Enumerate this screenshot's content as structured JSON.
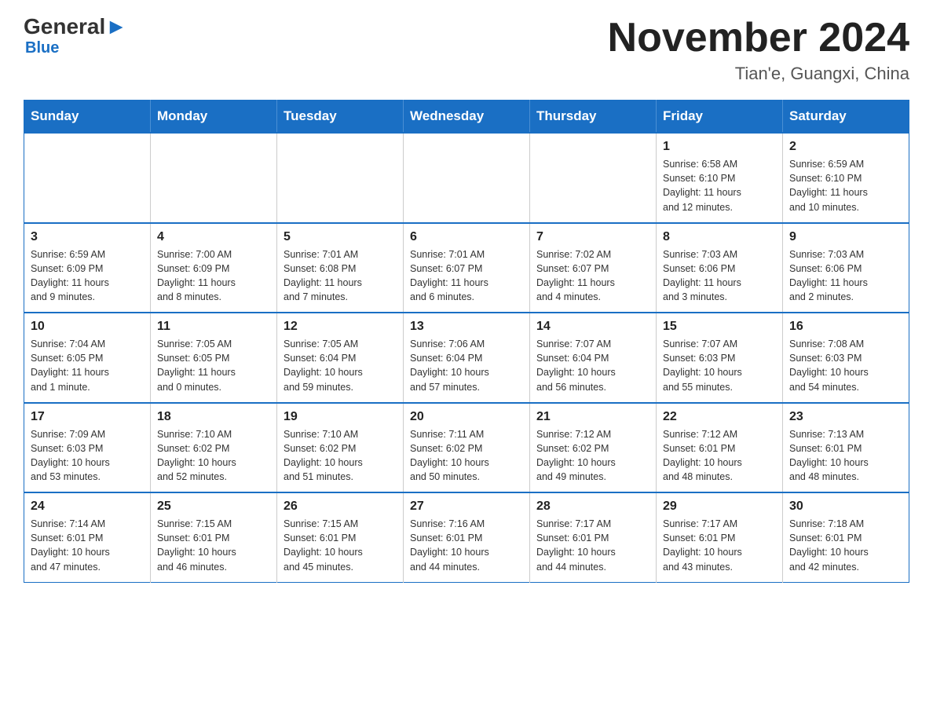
{
  "header": {
    "logo_general": "General",
    "logo_blue": "Blue",
    "month_title": "November 2024",
    "location": "Tian'e, Guangxi, China"
  },
  "weekdays": [
    "Sunday",
    "Monday",
    "Tuesday",
    "Wednesday",
    "Thursday",
    "Friday",
    "Saturday"
  ],
  "weeks": [
    {
      "days": [
        {
          "number": "",
          "info": "",
          "empty": true
        },
        {
          "number": "",
          "info": "",
          "empty": true
        },
        {
          "number": "",
          "info": "",
          "empty": true
        },
        {
          "number": "",
          "info": "",
          "empty": true
        },
        {
          "number": "",
          "info": "",
          "empty": true
        },
        {
          "number": "1",
          "info": "Sunrise: 6:58 AM\nSunset: 6:10 PM\nDaylight: 11 hours\nand 12 minutes."
        },
        {
          "number": "2",
          "info": "Sunrise: 6:59 AM\nSunset: 6:10 PM\nDaylight: 11 hours\nand 10 minutes."
        }
      ]
    },
    {
      "days": [
        {
          "number": "3",
          "info": "Sunrise: 6:59 AM\nSunset: 6:09 PM\nDaylight: 11 hours\nand 9 minutes."
        },
        {
          "number": "4",
          "info": "Sunrise: 7:00 AM\nSunset: 6:09 PM\nDaylight: 11 hours\nand 8 minutes."
        },
        {
          "number": "5",
          "info": "Sunrise: 7:01 AM\nSunset: 6:08 PM\nDaylight: 11 hours\nand 7 minutes."
        },
        {
          "number": "6",
          "info": "Sunrise: 7:01 AM\nSunset: 6:07 PM\nDaylight: 11 hours\nand 6 minutes."
        },
        {
          "number": "7",
          "info": "Sunrise: 7:02 AM\nSunset: 6:07 PM\nDaylight: 11 hours\nand 4 minutes."
        },
        {
          "number": "8",
          "info": "Sunrise: 7:03 AM\nSunset: 6:06 PM\nDaylight: 11 hours\nand 3 minutes."
        },
        {
          "number": "9",
          "info": "Sunrise: 7:03 AM\nSunset: 6:06 PM\nDaylight: 11 hours\nand 2 minutes."
        }
      ]
    },
    {
      "days": [
        {
          "number": "10",
          "info": "Sunrise: 7:04 AM\nSunset: 6:05 PM\nDaylight: 11 hours\nand 1 minute."
        },
        {
          "number": "11",
          "info": "Sunrise: 7:05 AM\nSunset: 6:05 PM\nDaylight: 11 hours\nand 0 minutes."
        },
        {
          "number": "12",
          "info": "Sunrise: 7:05 AM\nSunset: 6:04 PM\nDaylight: 10 hours\nand 59 minutes."
        },
        {
          "number": "13",
          "info": "Sunrise: 7:06 AM\nSunset: 6:04 PM\nDaylight: 10 hours\nand 57 minutes."
        },
        {
          "number": "14",
          "info": "Sunrise: 7:07 AM\nSunset: 6:04 PM\nDaylight: 10 hours\nand 56 minutes."
        },
        {
          "number": "15",
          "info": "Sunrise: 7:07 AM\nSunset: 6:03 PM\nDaylight: 10 hours\nand 55 minutes."
        },
        {
          "number": "16",
          "info": "Sunrise: 7:08 AM\nSunset: 6:03 PM\nDaylight: 10 hours\nand 54 minutes."
        }
      ]
    },
    {
      "days": [
        {
          "number": "17",
          "info": "Sunrise: 7:09 AM\nSunset: 6:03 PM\nDaylight: 10 hours\nand 53 minutes."
        },
        {
          "number": "18",
          "info": "Sunrise: 7:10 AM\nSunset: 6:02 PM\nDaylight: 10 hours\nand 52 minutes."
        },
        {
          "number": "19",
          "info": "Sunrise: 7:10 AM\nSunset: 6:02 PM\nDaylight: 10 hours\nand 51 minutes."
        },
        {
          "number": "20",
          "info": "Sunrise: 7:11 AM\nSunset: 6:02 PM\nDaylight: 10 hours\nand 50 minutes."
        },
        {
          "number": "21",
          "info": "Sunrise: 7:12 AM\nSunset: 6:02 PM\nDaylight: 10 hours\nand 49 minutes."
        },
        {
          "number": "22",
          "info": "Sunrise: 7:12 AM\nSunset: 6:01 PM\nDaylight: 10 hours\nand 48 minutes."
        },
        {
          "number": "23",
          "info": "Sunrise: 7:13 AM\nSunset: 6:01 PM\nDaylight: 10 hours\nand 48 minutes."
        }
      ]
    },
    {
      "days": [
        {
          "number": "24",
          "info": "Sunrise: 7:14 AM\nSunset: 6:01 PM\nDaylight: 10 hours\nand 47 minutes."
        },
        {
          "number": "25",
          "info": "Sunrise: 7:15 AM\nSunset: 6:01 PM\nDaylight: 10 hours\nand 46 minutes."
        },
        {
          "number": "26",
          "info": "Sunrise: 7:15 AM\nSunset: 6:01 PM\nDaylight: 10 hours\nand 45 minutes."
        },
        {
          "number": "27",
          "info": "Sunrise: 7:16 AM\nSunset: 6:01 PM\nDaylight: 10 hours\nand 44 minutes."
        },
        {
          "number": "28",
          "info": "Sunrise: 7:17 AM\nSunset: 6:01 PM\nDaylight: 10 hours\nand 44 minutes."
        },
        {
          "number": "29",
          "info": "Sunrise: 7:17 AM\nSunset: 6:01 PM\nDaylight: 10 hours\nand 43 minutes."
        },
        {
          "number": "30",
          "info": "Sunrise: 7:18 AM\nSunset: 6:01 PM\nDaylight: 10 hours\nand 42 minutes."
        }
      ]
    }
  ]
}
